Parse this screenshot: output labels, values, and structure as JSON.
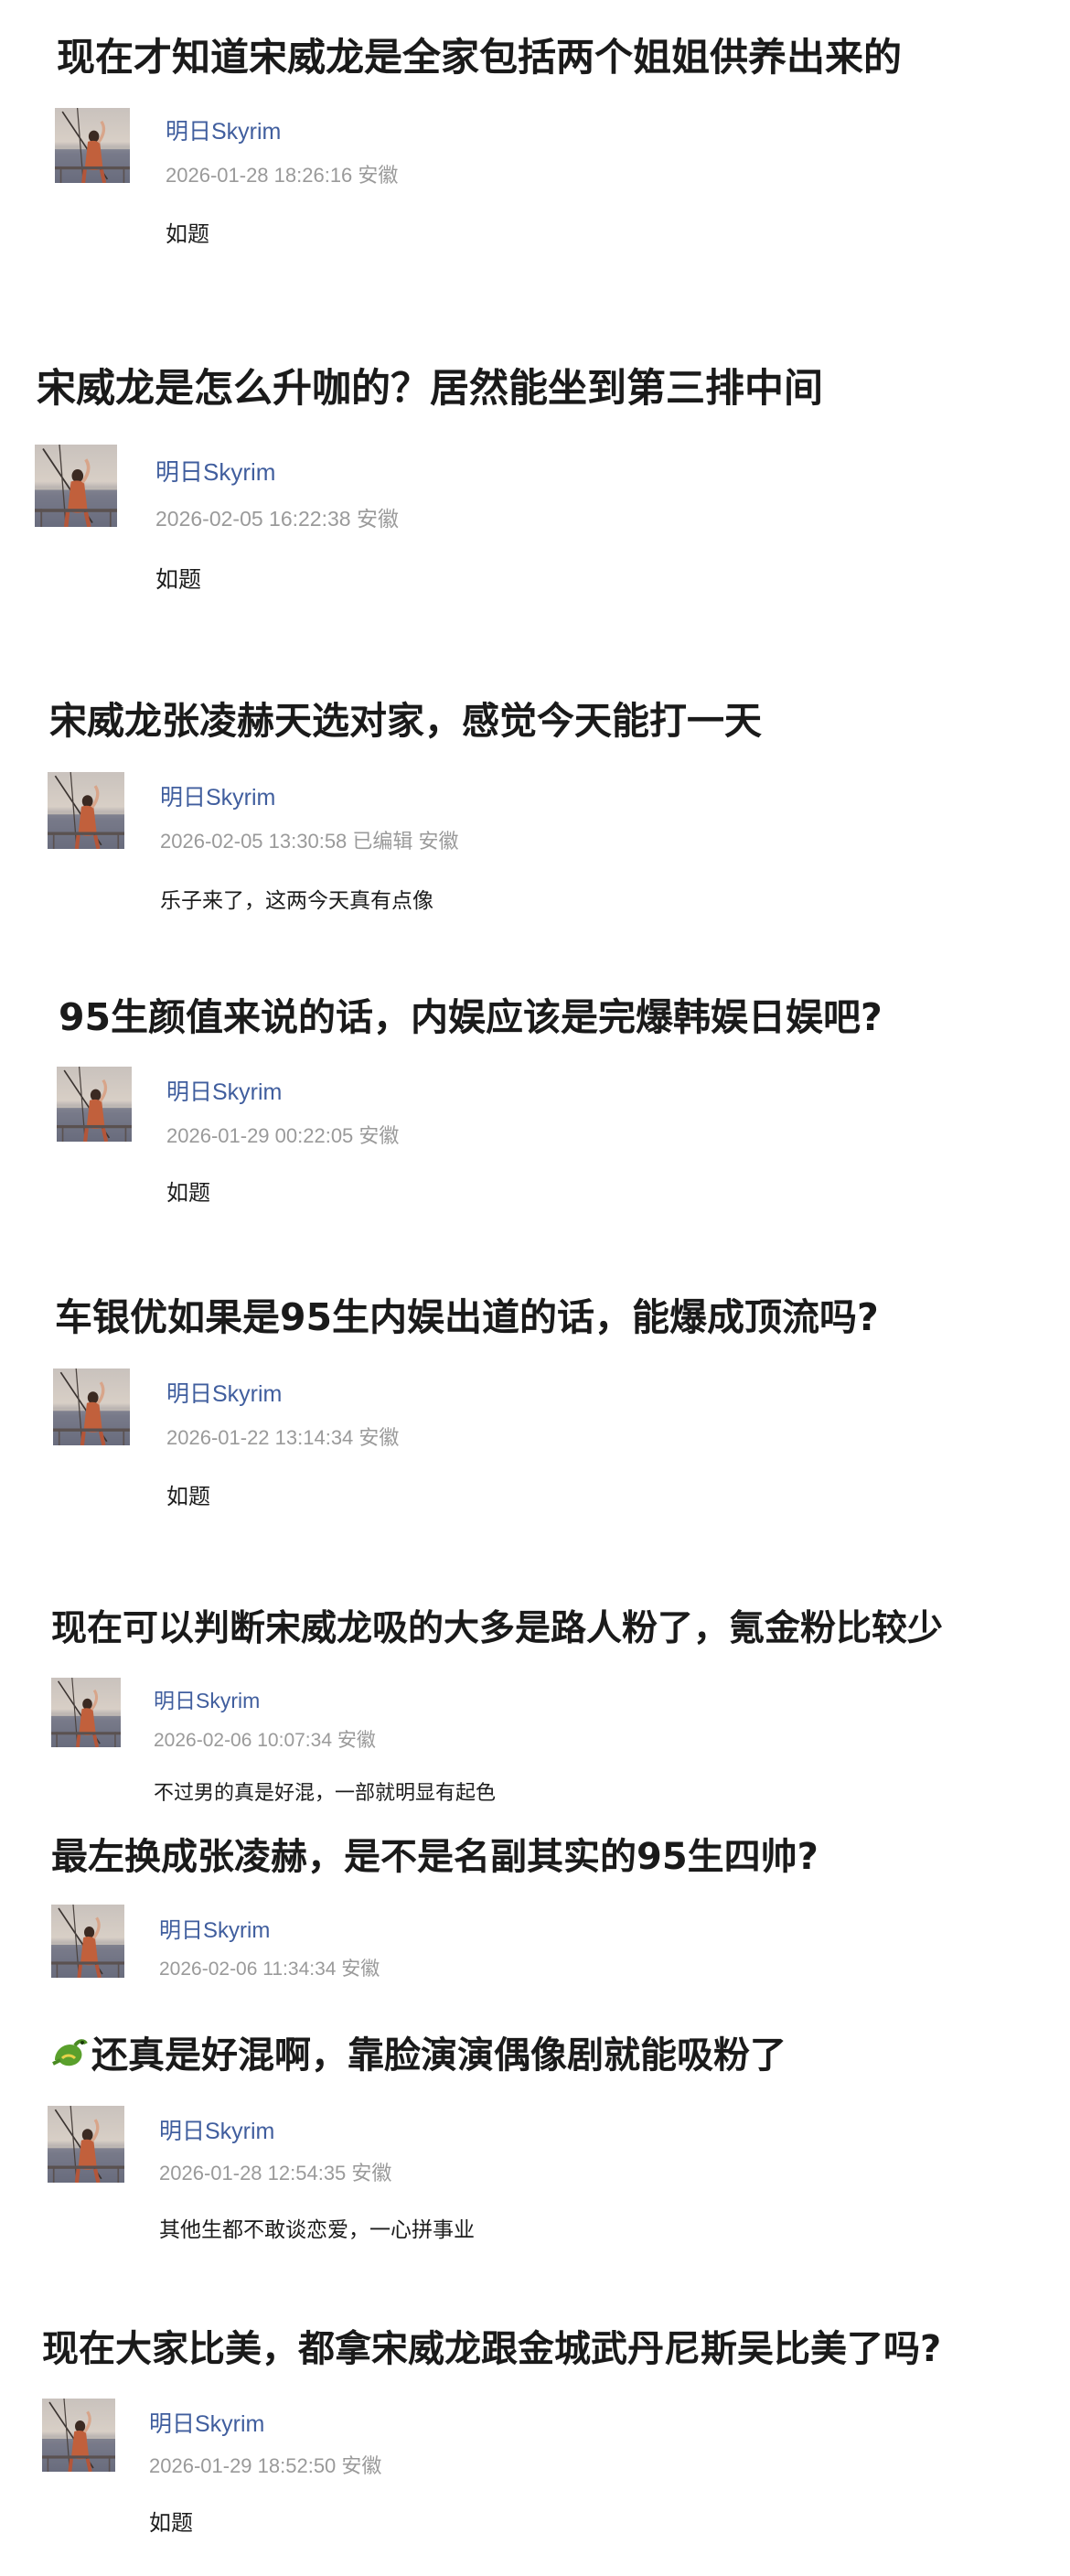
{
  "colors": {
    "username": "#405e9e",
    "meta": "#9a9a9a",
    "title": "#1a1a1a",
    "body": "#1c1c1c"
  },
  "posts": [
    {
      "title": "现在才知道宋威龙是全家包括两个姐姐供养出来的",
      "user": "明日Skyrim",
      "meta": "2026-01-28 18:26:16 安徽",
      "body": "如题"
    },
    {
      "title": "宋威龙是怎么升咖的？居然能坐到第三排中间",
      "user": "明日Skyrim",
      "meta": "2026-02-05 16:22:38 安徽",
      "body": "如题"
    },
    {
      "title": "宋威龙张凌赫天选对家，感觉今天能打一天",
      "user": "明日Skyrim",
      "meta": "2026-02-05 13:30:58 已编辑 安徽",
      "body": "乐子来了，这两今天真有点像"
    },
    {
      "title": "95生颜值来说的话，内娱应该是完爆韩娱日娱吧?",
      "user": "明日Skyrim",
      "meta": "2026-01-29 00:22:05 安徽",
      "body": "如题"
    },
    {
      "title": "车银优如果是95生内娱出道的话，能爆成顶流吗?",
      "user": "明日Skyrim",
      "meta": "2026-01-22 13:14:34 安徽",
      "body": "如题"
    },
    {
      "title": "现在可以判断宋威龙吸的大多是路人粉了，氪金粉比较少",
      "user": "明日Skyrim",
      "meta": "2026-02-06 10:07:34 安徽",
      "body": "不过男的真是好混，一部就明显有起色"
    },
    {
      "title": "最左换成张凌赫，是不是名副其实的95生四帅?",
      "user": "明日Skyrim",
      "meta": "2026-02-06 11:34:34 安徽",
      "body": ""
    },
    {
      "title": "还真是好混啊，靠脸演演偶像剧就能吸粉了",
      "title_icon": "dragon-emoji",
      "user": "明日Skyrim",
      "meta": "2026-01-28 12:54:35 安徽",
      "body": "其他生都不敢谈恋爱，一心拼事业"
    },
    {
      "title": "现在大家比美，都拿宋威龙跟金城武丹尼斯吴比美了吗?",
      "user": "明日Skyrim",
      "meta": "2026-01-29 18:52:50 安徽",
      "body": "如题"
    }
  ]
}
